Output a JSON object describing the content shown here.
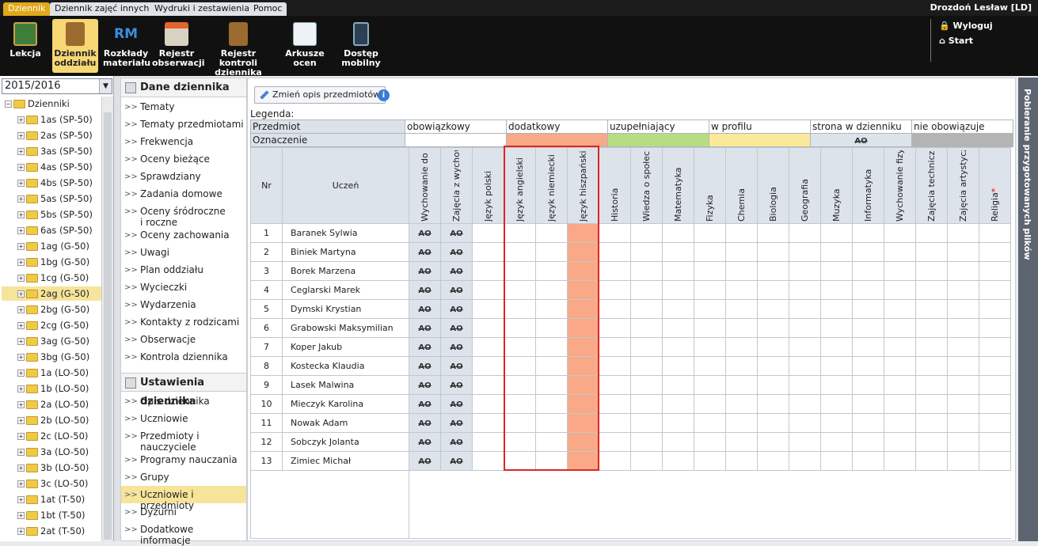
{
  "menubar": {
    "tabs": [
      "Dziennik",
      "Dziennik zajęć innych",
      "Wydruki i zestawienia",
      "Pomoc"
    ],
    "user": "Drozdoń Lesław [LD]"
  },
  "ribbon": {
    "buttons": [
      "Lekcja",
      "Dziennik oddziału",
      "Rozkłady materiału",
      "Rejestr obserwacji",
      "Rejestr kontroli dziennika",
      "Arkusze ocen",
      "Dostęp mobilny"
    ],
    "logout": "Wyloguj",
    "start": "Start"
  },
  "sidebar": {
    "year": "2015/2016",
    "root": "Dzienniki",
    "classes": [
      "1as (SP-50)",
      "2as (SP-50)",
      "3as (SP-50)",
      "4as (SP-50)",
      "4bs (SP-50)",
      "5as (SP-50)",
      "5bs (SP-50)",
      "6as (SP-50)",
      "1ag (G-50)",
      "1bg (G-50)",
      "1cg (G-50)",
      "2ag (G-50)",
      "2bg (G-50)",
      "2cg (G-50)",
      "3ag (G-50)",
      "3bg (G-50)",
      "1a (LO-50)",
      "1b (LO-50)",
      "2a (LO-50)",
      "2b (LO-50)",
      "2c (LO-50)",
      "3a (LO-50)",
      "3b (LO-50)",
      "3c (LO-50)",
      "1at (T-50)",
      "1bt (T-50)",
      "2at (T-50)"
    ],
    "selected": "2ag (G-50)"
  },
  "menu": {
    "section1": "Dane dziennika",
    "items1": [
      "Tematy",
      "Tematy przedmiotami",
      "Frekwencja",
      "Oceny bieżące",
      "Sprawdziany",
      "Zadania domowe",
      "Oceny śródroczne i roczne",
      "Oceny zachowania",
      "Uwagi",
      "Plan oddziału",
      "Wycieczki",
      "Wydarzenia",
      "Kontakty z rodzicami",
      "Obserwacje",
      "Kontrola dziennika"
    ],
    "section2": "Ustawienia dziennika",
    "items2": [
      "Opis dziennika",
      "Uczniowie",
      "Przedmioty i nauczyciele",
      "Programy nauczania",
      "Grupy",
      "Uczniowie i przedmioty",
      "Dyżurni",
      "Dodatkowe informacje"
    ],
    "selected": "Uczniowie i przedmioty"
  },
  "main": {
    "change_button": "Zmień opis przedmiotów",
    "legend_title": "Legenda:",
    "legend_row1_label": "Przedmiot",
    "legend_row2_label": "Oznaczenie",
    "legend_types": [
      "obowiązkowy",
      "dodatkowy",
      "uzupełniający",
      "w profilu",
      "strona w dzienniku",
      "nie obowiązuje"
    ],
    "legend_colors": [
      "#ffffff",
      "#f9a888",
      "#b7dc84",
      "#fbe99a",
      "#dde3ea",
      "#b4b4b4"
    ],
    "legend_strike": "AO",
    "col_nr": "Nr",
    "col_student": "Uczeń",
    "subjects": [
      "Wychowanie do",
      "Zajęcia z wychow",
      "Język polski",
      "Język angielski",
      "Język niemiecki",
      "Język hiszpański",
      "Historia",
      "Wiedza o społec",
      "Matematyka",
      "Fizyka",
      "Chemia",
      "Biologia",
      "Geografia",
      "Muzyka",
      "Informatyka",
      "Wychowanie fizy",
      "Zajęcia technicz",
      "Zajęcia artystycz",
      "Religia"
    ],
    "religia_star": "*",
    "ao": "AO",
    "students": [
      "Baranek Sylwia",
      "Biniek Martyna",
      "Borek Marzena",
      "Ceglarski Marek",
      "Dymski Krystian",
      "Grabowski Maksymilian",
      "Koper Jakub",
      "Kostecka Klaudia",
      "Lasek Malwina",
      "Mieczyk Karolina",
      "Nowak Adam",
      "Sobczyk Jolanta",
      "Zimiec Michał"
    ],
    "numbers": [
      "1",
      "2",
      "3",
      "4",
      "5",
      "6",
      "7",
      "8",
      "9",
      "10",
      "11",
      "12",
      "13"
    ]
  },
  "right_panel": {
    "label": "Pobieranie przygotowanych plików"
  }
}
